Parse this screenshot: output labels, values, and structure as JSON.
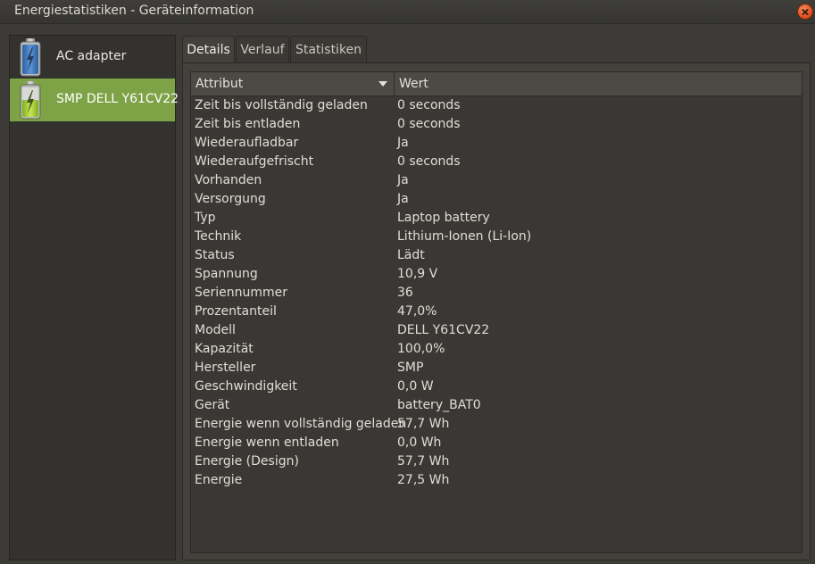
{
  "window": {
    "title": "Energiestatistiken - Geräteinformation"
  },
  "sidebar": {
    "items": [
      {
        "label": "AC adapter",
        "icon": "ac-adapter-battery-icon",
        "selected": false
      },
      {
        "label": "SMP DELL Y61CV22",
        "icon": "battery-charging-icon",
        "selected": true
      }
    ]
  },
  "tabs": [
    {
      "label": "Details",
      "active": true
    },
    {
      "label": "Verlauf",
      "active": false
    },
    {
      "label": "Statistiken",
      "active": false
    }
  ],
  "table": {
    "columns": {
      "attribute": "Attribut",
      "value": "Wert"
    },
    "rows": [
      {
        "attribute": "Zeit bis vollständig geladen",
        "value": "0 seconds"
      },
      {
        "attribute": "Zeit bis entladen",
        "value": "0 seconds"
      },
      {
        "attribute": "Wiederaufladbar",
        "value": "Ja"
      },
      {
        "attribute": "Wiederaufgefrischt",
        "value": "0 seconds"
      },
      {
        "attribute": "Vorhanden",
        "value": "Ja"
      },
      {
        "attribute": "Versorgung",
        "value": "Ja"
      },
      {
        "attribute": "Typ",
        "value": "Laptop battery"
      },
      {
        "attribute": "Technik",
        "value": "Lithium-Ionen (Li-Ion)"
      },
      {
        "attribute": "Status",
        "value": "Lädt"
      },
      {
        "attribute": "Spannung",
        "value": "10,9 V"
      },
      {
        "attribute": "Seriennummer",
        "value": "36"
      },
      {
        "attribute": "Prozentanteil",
        "value": "47,0%"
      },
      {
        "attribute": "Modell",
        "value": "DELL Y61CV22"
      },
      {
        "attribute": "Kapazität",
        "value": "100,0%"
      },
      {
        "attribute": "Hersteller",
        "value": "SMP"
      },
      {
        "attribute": "Geschwindigkeit",
        "value": "0,0 W"
      },
      {
        "attribute": "Gerät",
        "value": "battery_BAT0"
      },
      {
        "attribute": "Energie wenn vollständig geladen",
        "value": "57,7 Wh"
      },
      {
        "attribute": "Energie wenn entladen",
        "value": "0,0 Wh"
      },
      {
        "attribute": "Energie (Design)",
        "value": "57,7 Wh"
      },
      {
        "attribute": "Energie",
        "value": "27,5 Wh"
      }
    ]
  },
  "colors": {
    "selection": "#7ea346",
    "close_button": "#df4a16",
    "background": "#3c3b37"
  }
}
